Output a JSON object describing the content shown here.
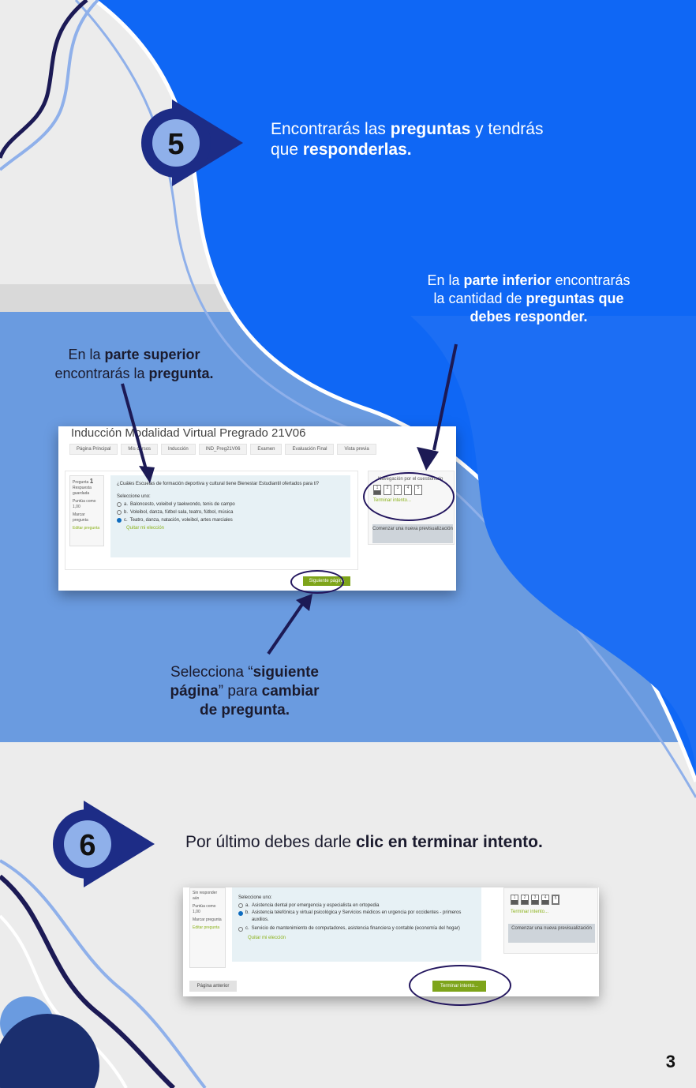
{
  "colors": {
    "blue": "#0f67f5",
    "mid_blue": "#6a9be0",
    "navy": "#1d2c86",
    "dark_navy": "#1c1a55",
    "grey_bg": "#ececec"
  },
  "step5": {
    "number": "5",
    "text_1": "Encontrarás las ",
    "text_bold_1": "preguntas",
    "text_2": " y tendrás",
    "text_3": "que ",
    "text_bold_2": "responderlas."
  },
  "callouts": {
    "lower": {
      "a": "En la ",
      "b": "parte inferior",
      "c": " encontrarás",
      "d": "la cantidad de ",
      "e": "preguntas que",
      "f": "debes responder."
    },
    "upper": {
      "a": "En la ",
      "b": "parte superior",
      "c": "encontrarás la ",
      "d": "pregunta."
    },
    "next": {
      "a": "Selecciona “",
      "b": "siguiente",
      "c": "página",
      "d": "” para ",
      "e": "cambiar",
      "f": "de pregunta."
    }
  },
  "screenshot1": {
    "course_title": "Inducción Modalidad Virtual Pregrado 21V06",
    "breadcrumbs": [
      "Página Principal",
      "Mis cursos",
      "Inducción",
      "IND_Preg21V06",
      "Examen",
      "Evaluación Final",
      "Vista previa"
    ],
    "qinfo": {
      "label": "Pregunta",
      "number": "1",
      "state": "Respuesta guardada",
      "score": "Puntúa como 1,00",
      "flag": "Marcar pregunta",
      "edit": "Editar pregunta"
    },
    "question": "¿Cuáles Escuelas de formación deportiva y cultural tiene Bienestar Estudiantil ofertados para ti?",
    "select_label": "Seleccione uno:",
    "options": [
      {
        "key": "a.",
        "text": "Baloncesto, voleibol y taekwondo, tenis de campo"
      },
      {
        "key": "b.",
        "text": "Voleibol, danza, fútbol sala, teatro, fútbol, música"
      },
      {
        "key": "c.",
        "text": "Teatro, danza, natación, voleibol, artes marciales"
      }
    ],
    "clear": "Quitar mi elección",
    "nav_title": "Navegación por el cuestionario",
    "nav_numbers": [
      "1",
      "2",
      "3",
      "4",
      "5"
    ],
    "finish_link": "Terminar intento...",
    "new_preview": "Comenzar una nueva previsualización",
    "next_button": "Siguiente página"
  },
  "step6": {
    "number": "6",
    "text_1": "Por último debes darle ",
    "text_bold": "clic en terminar intento."
  },
  "screenshot2": {
    "qinfo": {
      "state": "Sin responder aún",
      "score": "Puntúa como 1,00",
      "flag": "Marcar pregunta",
      "edit": "Editar pregunta"
    },
    "select_label": "Seleccione uno:",
    "options": [
      {
        "key": "a.",
        "text": "Asistencia dental por emergencia y especialista en ortopedia"
      },
      {
        "key": "b.",
        "text": "Asistencia telefónica y virtual psicológica y Servicios médicos en urgencia por occidentes - primeros auxilios."
      },
      {
        "key": "c.",
        "text": "Servicio de mantenimiento de computadores, asistencia financiera y contable (economía del hogar)"
      }
    ],
    "clear": "Quitar mi elección",
    "nav_numbers": [
      "1",
      "2",
      "3",
      "4",
      "5"
    ],
    "finish_link": "Terminar intento...",
    "new_preview": "Comenzar una nueva previsualización",
    "prev_button": "Página anterior",
    "finish_button": "Terminar intento..."
  },
  "page_number": "3"
}
